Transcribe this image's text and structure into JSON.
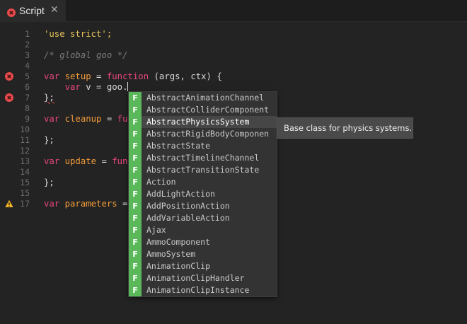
{
  "tab": {
    "title": "Script",
    "close_glyph": "✕",
    "status_icon": "error-icon"
  },
  "colors": {
    "background": "#232323",
    "keyword": "#e8467a",
    "identifier": "#f39c3c",
    "string": "#e8c45a",
    "comment": "#7a7a7a",
    "error": "#e84a4a",
    "warning": "#f0b429",
    "completion_badge": "#5ab85a"
  },
  "editor": {
    "lines": [
      {
        "num": "1",
        "marker": ""
      },
      {
        "num": "2",
        "marker": ""
      },
      {
        "num": "3",
        "marker": ""
      },
      {
        "num": "4",
        "marker": ""
      },
      {
        "num": "5",
        "marker": "error"
      },
      {
        "num": "6",
        "marker": ""
      },
      {
        "num": "7",
        "marker": "error"
      },
      {
        "num": "8",
        "marker": ""
      },
      {
        "num": "9",
        "marker": ""
      },
      {
        "num": "10",
        "marker": ""
      },
      {
        "num": "11",
        "marker": ""
      },
      {
        "num": "12",
        "marker": ""
      },
      {
        "num": "13",
        "marker": ""
      },
      {
        "num": "14",
        "marker": ""
      },
      {
        "num": "15",
        "marker": ""
      },
      {
        "num": "17",
        "marker": "warning"
      }
    ],
    "code": {
      "l1_str": "'use strict';",
      "l3_comment": "/* global goo */",
      "kw_var": "var",
      "kw_function": "function",
      "setup": "setup",
      "eq": " = ",
      "setup_args": " (args, ctx) {",
      "l6_indent": "    ",
      "l6_v": " v = goo.",
      "l7_close": "};",
      "cleanup": "cleanup",
      "fun_trunc": "fu",
      "update": "update",
      "update_fun_trunc": "fun",
      "parameters": "parameters",
      "params_eq": " =",
      "space": " "
    }
  },
  "autocomplete": {
    "kind_label": "F",
    "selected_index": 2,
    "items": [
      "AbstractAnimationChannel",
      "AbstractColliderComponent",
      "AbstractPhysicsSystem",
      "AbstractRigidBodyComponen",
      "AbstractState",
      "AbstractTimelineChannel",
      "AbstractTransitionState",
      "Action",
      "AddLightAction",
      "AddPositionAction",
      "AddVariableAction",
      "Ajax",
      "AmmoComponent",
      "AmmoSystem",
      "AnimationClip",
      "AnimationClipHandler",
      "AnimationClipInstance"
    ]
  },
  "tooltip": {
    "text": "Base class for physics systems."
  }
}
